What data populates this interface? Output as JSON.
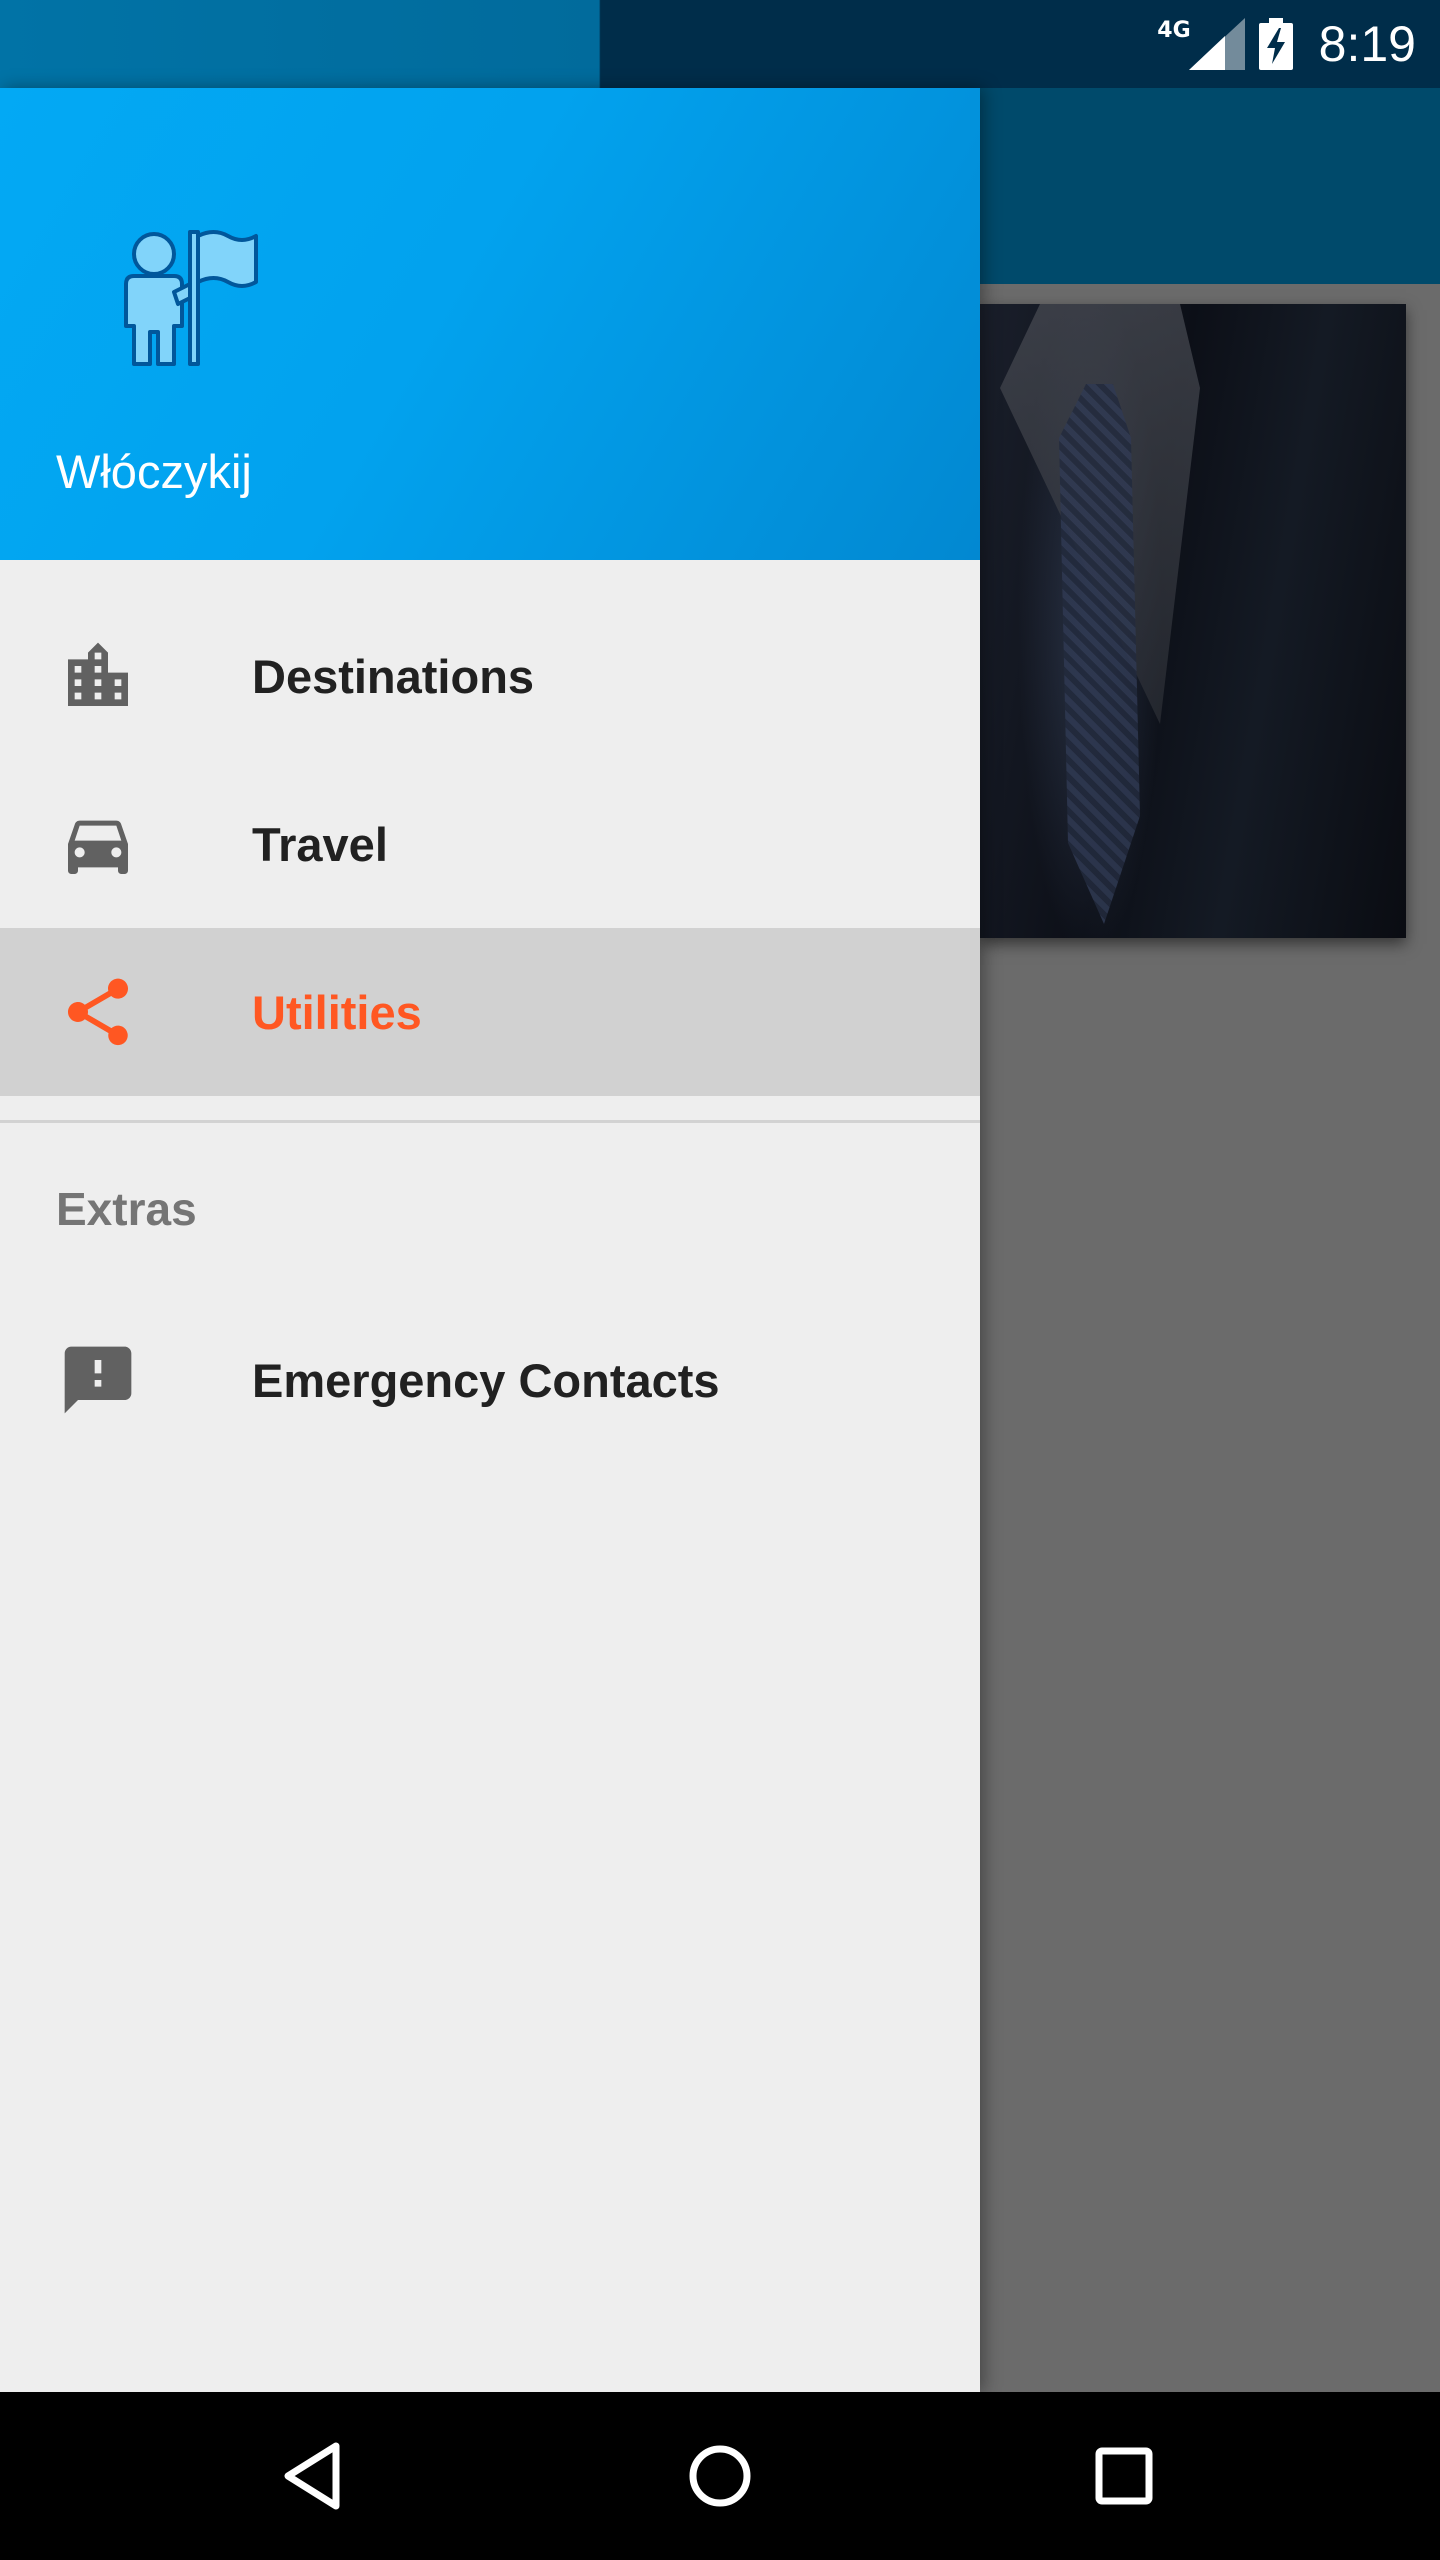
{
  "status_bar": {
    "network": "4G",
    "time": "8:19"
  },
  "drawer": {
    "header": {
      "app_name": "Włóczykij",
      "logo_icon": "traveler-with-flag-icon"
    },
    "items": [
      {
        "label": "Destinations",
        "icon": "city-buildings-icon",
        "selected": false
      },
      {
        "label": "Travel",
        "icon": "car-icon",
        "selected": false
      },
      {
        "label": "Utilities",
        "icon": "share-icon",
        "selected": true
      }
    ],
    "section_title": "Extras",
    "extra_items": [
      {
        "label": "Emergency Contacts",
        "icon": "feedback-alert-icon"
      }
    ]
  },
  "colors": {
    "header_blue": "#03a9f4",
    "accent": "#ff5722",
    "selected_bg": "#d1d1d1",
    "icon_gray": "#616161"
  },
  "nav_bar": {
    "back_icon": "back-triangle-icon",
    "home_icon": "home-circle-icon",
    "recents_icon": "recents-square-icon"
  }
}
